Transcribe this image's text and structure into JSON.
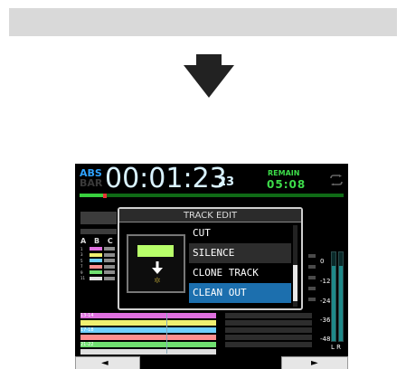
{
  "counter": {
    "mode_label": "ABS",
    "mode_alt_label": "BAR",
    "time": "00:01:23",
    "frames": "23"
  },
  "remain": {
    "label": "REMAIN",
    "value": "05:08"
  },
  "progress": {
    "fraction": 0.1
  },
  "track_header": {
    "columns": "A B C D"
  },
  "track_numbers": [
    "1",
    "3",
    "5",
    "7",
    "9",
    "11",
    "13-14",
    "15-16",
    "17-18",
    "21-22"
  ],
  "dialog": {
    "title": "TRACK EDIT",
    "items": [
      "CUT",
      "SILENCE",
      "CLONE TRACK",
      "CLEAN OUT"
    ],
    "highlighted_item": "SILENCE",
    "selected_item": "CLEAN OUT"
  },
  "meter_scale": [
    "0",
    "-12",
    "-24",
    "-36",
    "-48"
  ],
  "meter_channels": "L R",
  "buttons": {
    "left_glyph": "◄",
    "right_glyph": "►"
  },
  "colors": {
    "counter_text": "#d9f2ff",
    "remain_green": "#3ddc4a",
    "selected_blue": "#1c6fae",
    "icon_green": "#b8ff6a"
  },
  "icons": {
    "loop": "loop-icon",
    "down_arrow": "down-arrow-icon"
  }
}
